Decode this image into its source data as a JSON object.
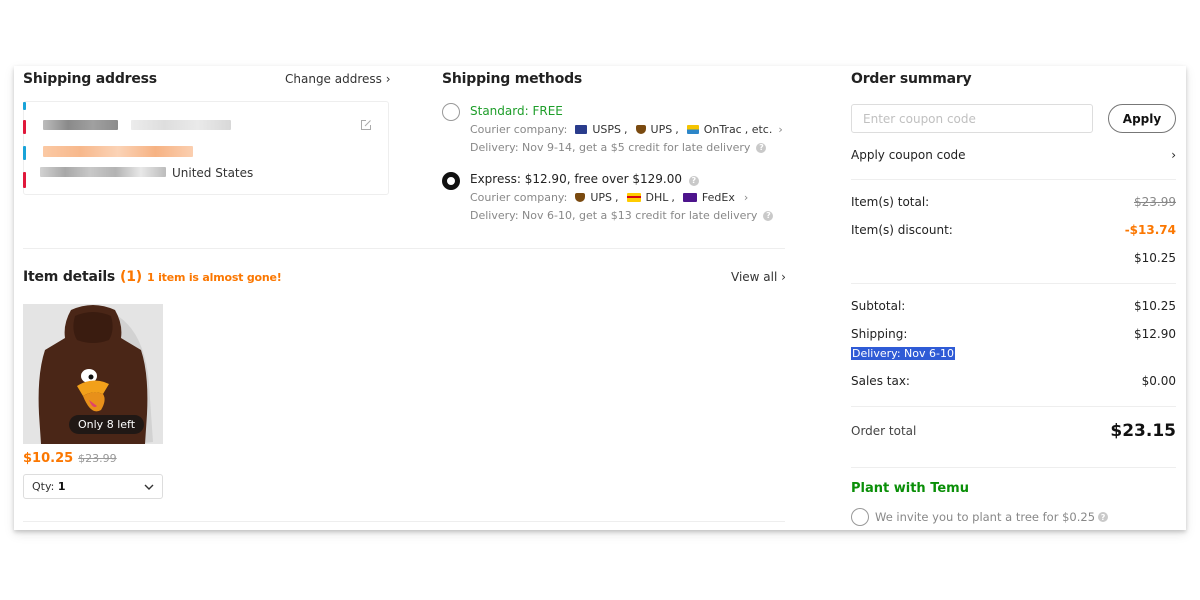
{
  "shipping_address": {
    "title": "Shipping address",
    "change_label": "Change address",
    "country": "United States"
  },
  "shipping_methods": {
    "title": "Shipping methods",
    "courier_prefix": "Courier company:",
    "options": [
      {
        "title": "Standard: FREE",
        "selected": false,
        "title_color": "#1e9e2a",
        "couriers": [
          "USPS",
          "UPS",
          "OnTrac"
        ],
        "couriers_suffix": ", etc.",
        "delivery": "Delivery: Nov 9-14, get a $5 credit for late delivery"
      },
      {
        "title": "Express: $12.90, free over $129.00",
        "selected": true,
        "title_color": "#222222",
        "couriers": [
          "UPS",
          "DHL",
          "FedEx"
        ],
        "couriers_suffix": "",
        "delivery": "Delivery: Nov 6-10, get a $13 credit for late delivery"
      }
    ]
  },
  "item_details": {
    "title": "Item details",
    "count": "(1)",
    "warning": "1 item is almost gone!",
    "view_all": "View all",
    "items": [
      {
        "stock_badge": "Only 8 left",
        "price": "$10.25",
        "original_price": "$23.99",
        "qty_label": "Qty:",
        "qty": "1"
      }
    ]
  },
  "order_summary": {
    "title": "Order summary",
    "coupon_placeholder": "Enter coupon code",
    "coupon_value": "",
    "apply_label": "Apply",
    "apply_coupon_link": "Apply coupon code",
    "items_total_label": "Item(s) total:",
    "items_total": "$23.99",
    "items_discount_label": "Item(s) discount:",
    "items_discount": "-$13.74",
    "items_after_discount": "$10.25",
    "subtotal_label": "Subtotal:",
    "subtotal": "$10.25",
    "shipping_label": "Shipping:",
    "shipping": "$12.90",
    "shipping_delivery": "Delivery: Nov 6-10",
    "sales_tax_label": "Sales tax:",
    "sales_tax": "$0.00",
    "order_total_label": "Order total",
    "order_total": "$23.15",
    "plant_title": "Plant with Temu",
    "plant_text": "We invite you to plant a tree for $0.25",
    "plant_selected": false
  },
  "colors": {
    "accent_orange": "#fb7701",
    "green": "#0a8f08",
    "selection_blue": "#2f5bd6"
  }
}
